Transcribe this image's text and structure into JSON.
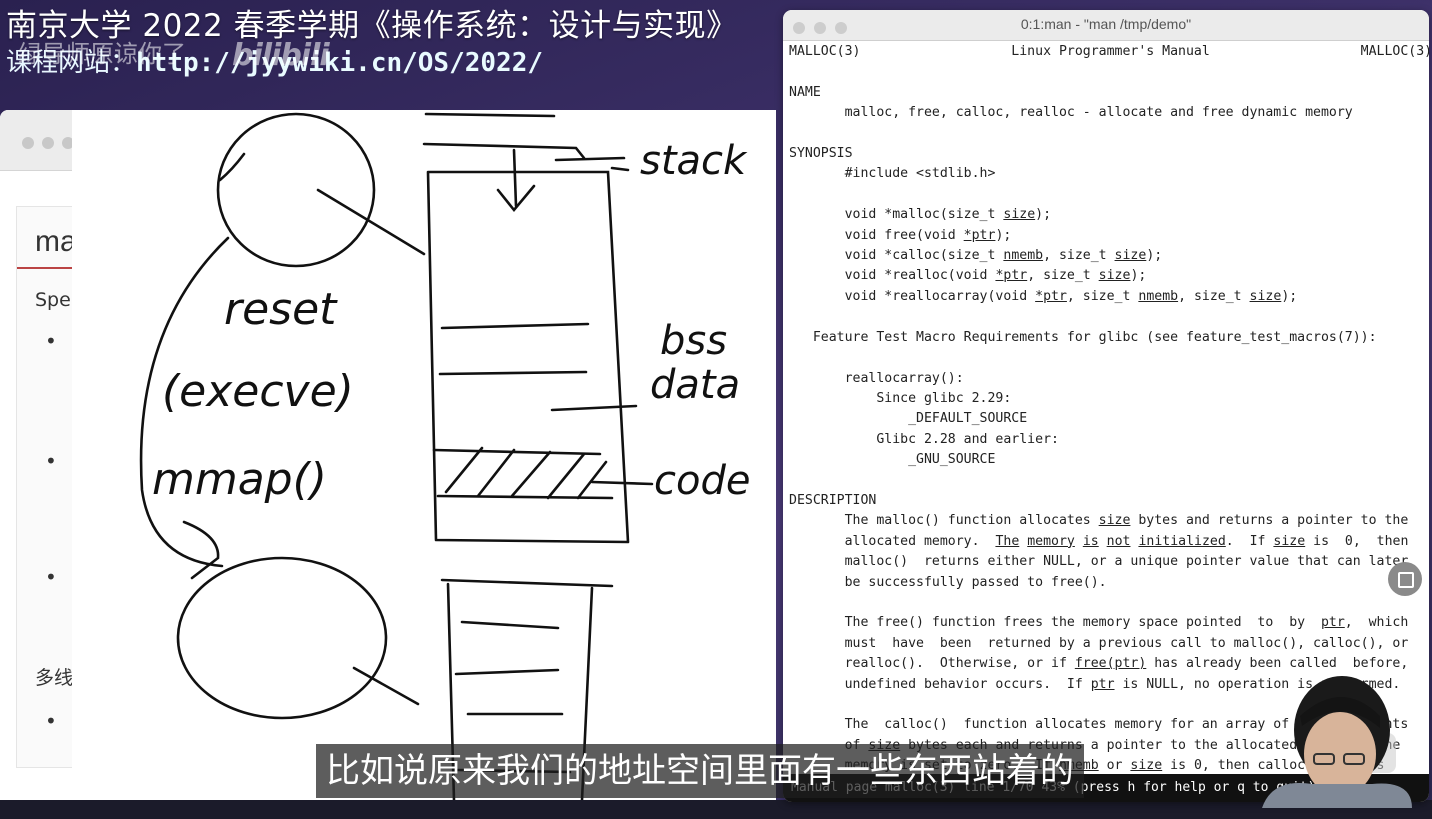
{
  "banner": {
    "title": "南京大学 2022 春季学期《操作系统：设计与实现》",
    "site_label": "课程网站：",
    "site_url": "http://jyywiki.cn/OS/2022/"
  },
  "watermark": {
    "text": "绿导师原谅你了",
    "logo": "bilibili"
  },
  "browser": {
    "slide_heading": "ma",
    "subheading": "Spe",
    "bullets": [
      "•",
      "•",
      "•"
    ],
    "section2": "多线",
    "section2_bullets": [
      "•"
    ]
  },
  "whiteboard": {
    "labels": {
      "stack": "stack",
      "bss": "bss",
      "data": "data",
      "code": "code",
      "reset": "reset",
      "execve": "(execve)",
      "mmap": "mmap()"
    }
  },
  "terminal": {
    "title": "0:1:man - \"man /tmp/demo\"",
    "status": "Manual page malloc(3) line 1/70 43% (press h for help or q to quit)"
  },
  "subtitle": "比如说原来我们的地址空间里面有一些东西站着的"
}
